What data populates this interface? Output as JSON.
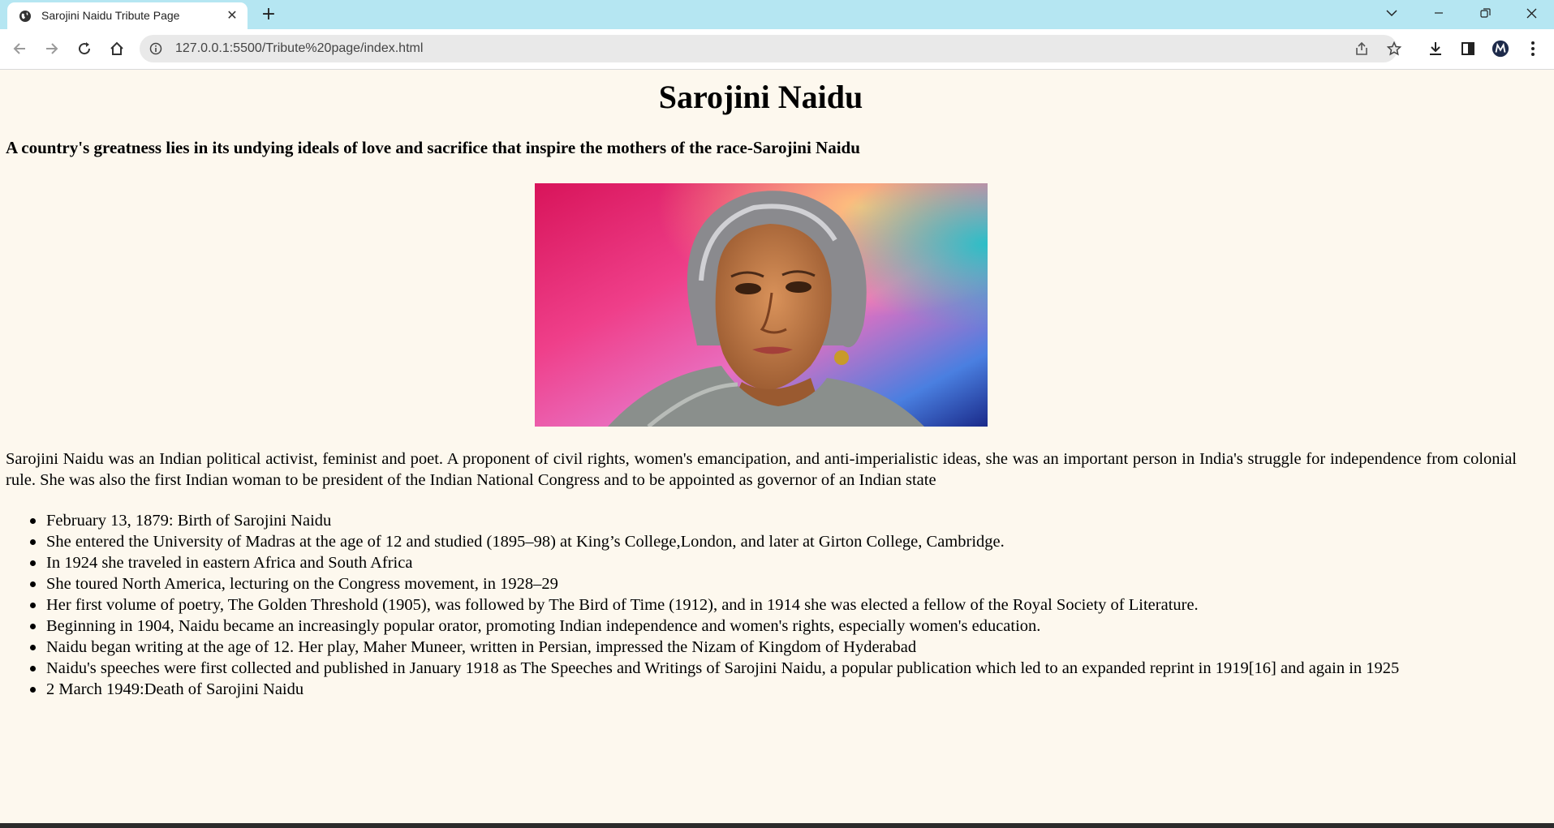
{
  "browser": {
    "tab_title": "Sarojini Naidu Tribute Page",
    "url": "127.0.0.1:5500/Tribute%20page/index.html",
    "icons": [
      "globe-icon",
      "close-icon",
      "plus-icon",
      "chevron-down-icon",
      "minimize-icon",
      "restore-icon",
      "window-close-icon",
      "back-icon",
      "forward-icon",
      "reload-icon",
      "home-icon",
      "info-icon",
      "share-icon",
      "star-icon",
      "download-icon",
      "side-panel-icon",
      "profile-avatar",
      "menu-icon"
    ]
  },
  "page": {
    "title": "Sarojini Naidu",
    "quote": "A country's greatness lies in its undying ideals of love and sacrifice that inspire the mothers of the race-Sarojini Naidu",
    "bio": "Sarojini Naidu was an Indian political activist, feminist and poet. A proponent of civil rights, women's emancipation, and anti-imperialistic ideas, she was an important person in India's struggle for independence from colonial rule. She was also the first Indian woman to be president of the Indian National Congress and to be appointed as governor of an Indian state",
    "facts": [
      "February 13, 1879: Birth of Sarojini Naidu",
      "She entered the University of Madras at the age of 12 and studied (1895–98) at King’s College,London, and later at Girton College, Cambridge.",
      "In 1924 she traveled in eastern Africa and South Africa",
      "She toured North America, lecturing on the Congress movement, in 1928–29",
      "Her first volume of poetry, The Golden Threshold (1905), was followed by The Bird of Time (1912), and in 1914 she was elected a fellow of the Royal Society of Literature.",
      "Beginning in 1904, Naidu became an increasingly popular orator, promoting Indian independence and women's rights, especially women's education.",
      "Naidu began writing at the age of 12. Her play, Maher Muneer, written in Persian, impressed the Nizam of Kingdom of Hyderabad",
      "Naidu's speeches were first collected and published in January 1918 as The Speeches and Writings of Sarojini Naidu, a popular publication which led to an expanded reprint in 1919[16] and again in 1925",
      "2 March 1949:Death of Sarojini Naidu"
    ]
  },
  "colors": {
    "page_background": "#fdf8ee",
    "tabbar": "#b5e6f2",
    "omnibox": "#e9e9e9"
  }
}
